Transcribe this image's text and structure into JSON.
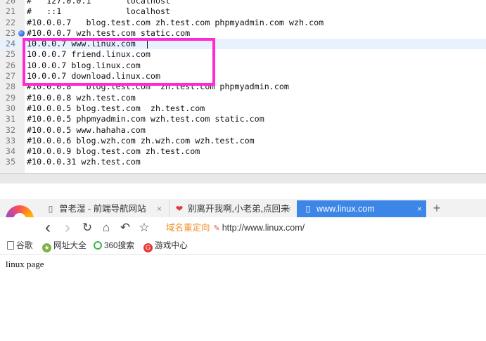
{
  "editor": {
    "lines": [
      {
        "number": "20",
        "text": "#   127.0.0.1       localhost"
      },
      {
        "number": "21",
        "text": "#   ::1             localhost"
      },
      {
        "number": "22",
        "text": "#10.0.0.7   blog.test.com zh.test.com phpmyadmin.com wzh.com"
      },
      {
        "number": "23",
        "text": "#10.0.0.7 wzh.test.com static.com"
      },
      {
        "number": "24",
        "text": "10.0.0.7 www.linux.com"
      },
      {
        "number": "25",
        "text": "10.0.0.7 friend.linux.com"
      },
      {
        "number": "26",
        "text": "10.0.0.7 blog.linux.com"
      },
      {
        "number": "27",
        "text": "10.0.0.7 download.linux.com"
      },
      {
        "number": "28",
        "text": "#10.0.0.8   blog.test.com  zh.test.com phpmyadmin.com"
      },
      {
        "number": "29",
        "text": "#10.0.0.8 wzh.test.com"
      },
      {
        "number": "30",
        "text": "#10.0.0.5 blog.test.com  zh.test.com"
      },
      {
        "number": "31",
        "text": "#10.0.0.5 phpmyadmin.com wzh.test.com static.com"
      },
      {
        "number": "32",
        "text": "#10.0.0.5 www.hahaha.com"
      },
      {
        "number": "33",
        "text": "#10.0.0.6 blog.wzh.com zh.wzh.com wzh.test.com"
      },
      {
        "number": "34",
        "text": "#10.0.0.9 blog.test.com zh.test.com"
      },
      {
        "number": "35",
        "text": "#10.0.0.31 wzh.test.com"
      }
    ],
    "current_line": "24",
    "bookmark_line": "23",
    "highlight_color": "#ff2ad4"
  },
  "browser": {
    "tabs": [
      {
        "label": "曾老湿 - 前端导航网站",
        "icon": "page-icon",
        "close": "×",
        "active": false
      },
      {
        "label": "别离开我啊,小老弟,点回来",
        "icon": "lips-icon",
        "close": "×",
        "active": false
      },
      {
        "label": "www.linux.com",
        "icon": "page-icon",
        "close": "×",
        "active": true
      }
    ],
    "new_tab": "+",
    "nav": {
      "back": "‹",
      "forward": "›",
      "reload": "↻",
      "home": "⌂",
      "undo": "↶",
      "favorite": "☆"
    },
    "address": {
      "redirect_label": "域名重定向",
      "url": "http://www.linux.com/"
    },
    "bookmarks": [
      {
        "label": "谷歌",
        "icon": "page-icon"
      },
      {
        "label": "网址大全",
        "icon": "site-nav-icon"
      },
      {
        "label": "360搜索",
        "icon": "search-360-icon"
      },
      {
        "label": "游戏中心",
        "icon": "game-center-icon"
      }
    ],
    "page_text": "linux page",
    "accent_color": "#3c86e8"
  }
}
